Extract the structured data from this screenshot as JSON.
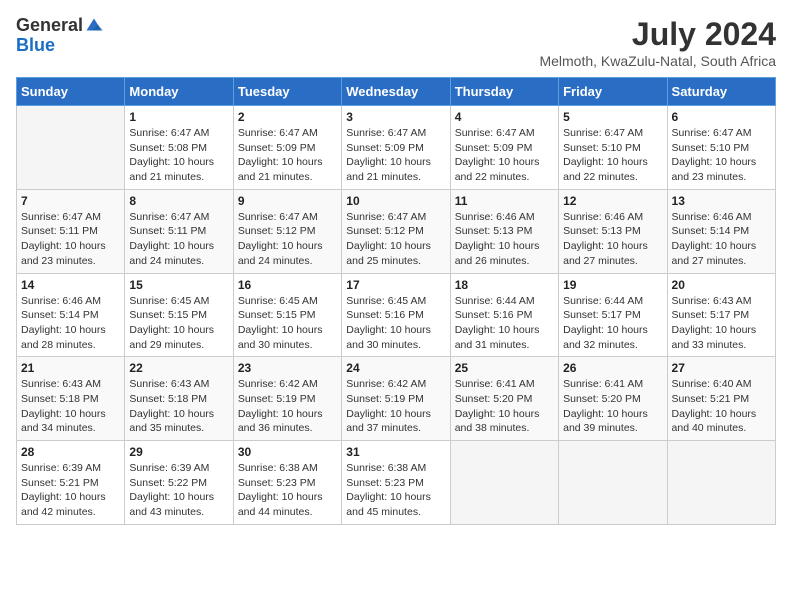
{
  "logo": {
    "general": "General",
    "blue": "Blue"
  },
  "title": "July 2024",
  "subtitle": "Melmoth, KwaZulu-Natal, South Africa",
  "weekdays": [
    "Sunday",
    "Monday",
    "Tuesday",
    "Wednesday",
    "Thursday",
    "Friday",
    "Saturday"
  ],
  "weeks": [
    [
      {
        "day": "",
        "info": ""
      },
      {
        "day": "1",
        "info": "Sunrise: 6:47 AM\nSunset: 5:08 PM\nDaylight: 10 hours\nand 21 minutes."
      },
      {
        "day": "2",
        "info": "Sunrise: 6:47 AM\nSunset: 5:09 PM\nDaylight: 10 hours\nand 21 minutes."
      },
      {
        "day": "3",
        "info": "Sunrise: 6:47 AM\nSunset: 5:09 PM\nDaylight: 10 hours\nand 21 minutes."
      },
      {
        "day": "4",
        "info": "Sunrise: 6:47 AM\nSunset: 5:09 PM\nDaylight: 10 hours\nand 22 minutes."
      },
      {
        "day": "5",
        "info": "Sunrise: 6:47 AM\nSunset: 5:10 PM\nDaylight: 10 hours\nand 22 minutes."
      },
      {
        "day": "6",
        "info": "Sunrise: 6:47 AM\nSunset: 5:10 PM\nDaylight: 10 hours\nand 23 minutes."
      }
    ],
    [
      {
        "day": "7",
        "info": "Sunrise: 6:47 AM\nSunset: 5:11 PM\nDaylight: 10 hours\nand 23 minutes."
      },
      {
        "day": "8",
        "info": "Sunrise: 6:47 AM\nSunset: 5:11 PM\nDaylight: 10 hours\nand 24 minutes."
      },
      {
        "day": "9",
        "info": "Sunrise: 6:47 AM\nSunset: 5:12 PM\nDaylight: 10 hours\nand 24 minutes."
      },
      {
        "day": "10",
        "info": "Sunrise: 6:47 AM\nSunset: 5:12 PM\nDaylight: 10 hours\nand 25 minutes."
      },
      {
        "day": "11",
        "info": "Sunrise: 6:46 AM\nSunset: 5:13 PM\nDaylight: 10 hours\nand 26 minutes."
      },
      {
        "day": "12",
        "info": "Sunrise: 6:46 AM\nSunset: 5:13 PM\nDaylight: 10 hours\nand 27 minutes."
      },
      {
        "day": "13",
        "info": "Sunrise: 6:46 AM\nSunset: 5:14 PM\nDaylight: 10 hours\nand 27 minutes."
      }
    ],
    [
      {
        "day": "14",
        "info": "Sunrise: 6:46 AM\nSunset: 5:14 PM\nDaylight: 10 hours\nand 28 minutes."
      },
      {
        "day": "15",
        "info": "Sunrise: 6:45 AM\nSunset: 5:15 PM\nDaylight: 10 hours\nand 29 minutes."
      },
      {
        "day": "16",
        "info": "Sunrise: 6:45 AM\nSunset: 5:15 PM\nDaylight: 10 hours\nand 30 minutes."
      },
      {
        "day": "17",
        "info": "Sunrise: 6:45 AM\nSunset: 5:16 PM\nDaylight: 10 hours\nand 30 minutes."
      },
      {
        "day": "18",
        "info": "Sunrise: 6:44 AM\nSunset: 5:16 PM\nDaylight: 10 hours\nand 31 minutes."
      },
      {
        "day": "19",
        "info": "Sunrise: 6:44 AM\nSunset: 5:17 PM\nDaylight: 10 hours\nand 32 minutes."
      },
      {
        "day": "20",
        "info": "Sunrise: 6:43 AM\nSunset: 5:17 PM\nDaylight: 10 hours\nand 33 minutes."
      }
    ],
    [
      {
        "day": "21",
        "info": "Sunrise: 6:43 AM\nSunset: 5:18 PM\nDaylight: 10 hours\nand 34 minutes."
      },
      {
        "day": "22",
        "info": "Sunrise: 6:43 AM\nSunset: 5:18 PM\nDaylight: 10 hours\nand 35 minutes."
      },
      {
        "day": "23",
        "info": "Sunrise: 6:42 AM\nSunset: 5:19 PM\nDaylight: 10 hours\nand 36 minutes."
      },
      {
        "day": "24",
        "info": "Sunrise: 6:42 AM\nSunset: 5:19 PM\nDaylight: 10 hours\nand 37 minutes."
      },
      {
        "day": "25",
        "info": "Sunrise: 6:41 AM\nSunset: 5:20 PM\nDaylight: 10 hours\nand 38 minutes."
      },
      {
        "day": "26",
        "info": "Sunrise: 6:41 AM\nSunset: 5:20 PM\nDaylight: 10 hours\nand 39 minutes."
      },
      {
        "day": "27",
        "info": "Sunrise: 6:40 AM\nSunset: 5:21 PM\nDaylight: 10 hours\nand 40 minutes."
      }
    ],
    [
      {
        "day": "28",
        "info": "Sunrise: 6:39 AM\nSunset: 5:21 PM\nDaylight: 10 hours\nand 42 minutes."
      },
      {
        "day": "29",
        "info": "Sunrise: 6:39 AM\nSunset: 5:22 PM\nDaylight: 10 hours\nand 43 minutes."
      },
      {
        "day": "30",
        "info": "Sunrise: 6:38 AM\nSunset: 5:23 PM\nDaylight: 10 hours\nand 44 minutes."
      },
      {
        "day": "31",
        "info": "Sunrise: 6:38 AM\nSunset: 5:23 PM\nDaylight: 10 hours\nand 45 minutes."
      },
      {
        "day": "",
        "info": ""
      },
      {
        "day": "",
        "info": ""
      },
      {
        "day": "",
        "info": ""
      }
    ]
  ]
}
